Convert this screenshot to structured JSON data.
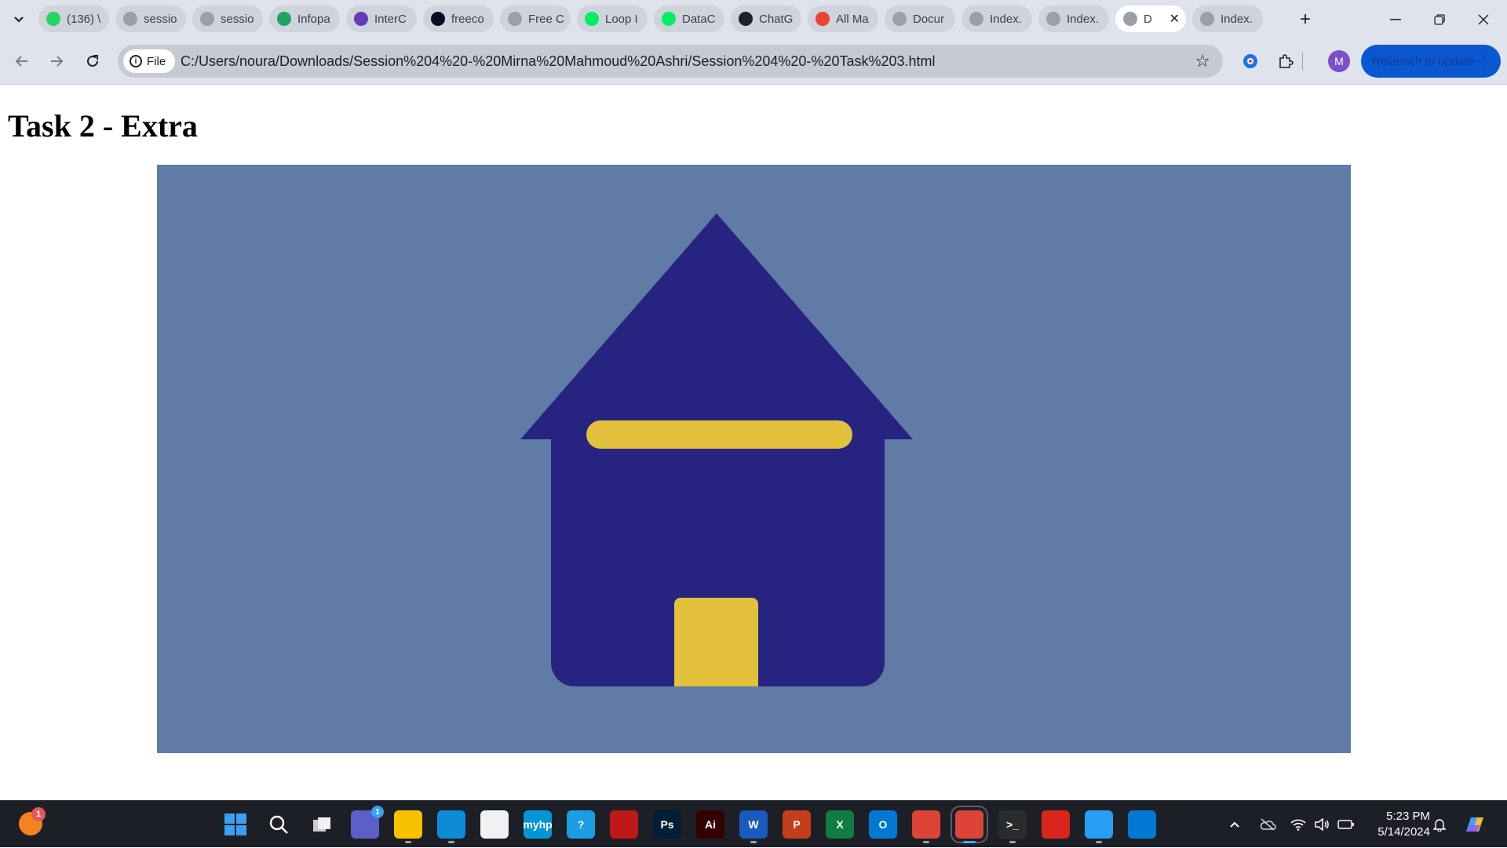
{
  "browser": {
    "tabs": [
      {
        "label": "(136) \\",
        "icon": "whatsapp-icon",
        "color": "#25d366"
      },
      {
        "label": "sessio",
        "icon": "globe-icon",
        "color": "#9aa0a6"
      },
      {
        "label": "sessio",
        "icon": "globe-icon",
        "color": "#9aa0a6"
      },
      {
        "label": "Infopa",
        "icon": "google-drive-icon",
        "color": "#1fa463"
      },
      {
        "label": "InterC",
        "icon": "forms-icon",
        "color": "#673ab7"
      },
      {
        "label": "freeco",
        "icon": "freecodecamp-icon",
        "color": "#0a0a23"
      },
      {
        "label": "Free C",
        "icon": "globe-icon",
        "color": "#9aa0a6"
      },
      {
        "label": "Loop I",
        "icon": "datacamp-icon",
        "color": "#03ef62"
      },
      {
        "label": "DataC",
        "icon": "datacamp-icon",
        "color": "#03ef62"
      },
      {
        "label": "ChatG",
        "icon": "chatgpt-icon",
        "color": "#202124"
      },
      {
        "label": "All Ma",
        "icon": "gmail-icon",
        "color": "#ea4335"
      },
      {
        "label": "Docur",
        "icon": "globe-icon",
        "color": "#9aa0a6"
      },
      {
        "label": "Index.",
        "icon": "globe-icon",
        "color": "#9aa0a6"
      },
      {
        "label": "Index.",
        "icon": "globe-icon",
        "color": "#9aa0a6"
      },
      {
        "label": "D",
        "icon": "globe-icon",
        "color": "#9aa0a6",
        "active": true
      },
      {
        "label": "Index.",
        "icon": "globe-icon",
        "color": "#9aa0a6"
      }
    ],
    "file_chip": "File",
    "url": "C:/Users/noura/Downloads/Session%204%20-%20Mirna%20Mahmoud%20Ashri/Session%204%20-%20Task%203.html",
    "profile_initial": "M",
    "relaunch_label": "Relaunch to update"
  },
  "page": {
    "heading": "Task 2 - Extra",
    "colors": {
      "background": "#607ca6",
      "house": "#262480",
      "accent": "#e2c13b"
    }
  },
  "taskbar": {
    "start_badge": "1",
    "teams_badge": "1",
    "time": "5:23 PM",
    "date": "5/14/2024",
    "apps": [
      {
        "name": "start-button",
        "label": "",
        "color": "#1e90ff"
      },
      {
        "name": "search-button",
        "label": "",
        "color": "transparent"
      },
      {
        "name": "task-view-button",
        "label": "",
        "color": "transparent"
      },
      {
        "name": "teams-button",
        "label": "",
        "color": "#5b5fc7"
      },
      {
        "name": "file-explorer-button",
        "label": "",
        "color": "#f8c200"
      },
      {
        "name": "edge-button",
        "label": "",
        "color": "#0c8bd6"
      },
      {
        "name": "store-button",
        "label": "",
        "color": "#f1f1f1"
      },
      {
        "name": "myhp-button",
        "label": "myhp",
        "color": "#0096d6"
      },
      {
        "name": "help-button",
        "label": "?",
        "color": "#1b9de2"
      },
      {
        "name": "mcafee-button",
        "label": "",
        "color": "#c01818"
      },
      {
        "name": "photoshop-button",
        "label": "Ps",
        "color": "#001e36"
      },
      {
        "name": "illustrator-button",
        "label": "Ai",
        "color": "#330000"
      },
      {
        "name": "word-button",
        "label": "W",
        "color": "#185abd"
      },
      {
        "name": "powerpoint-button",
        "label": "P",
        "color": "#c43e1c"
      },
      {
        "name": "excel-button",
        "label": "X",
        "color": "#107c41"
      },
      {
        "name": "outlook-button",
        "label": "O",
        "color": "#0078d4"
      },
      {
        "name": "chrome-button",
        "label": "",
        "color": "#db4437"
      },
      {
        "name": "chrome-profile-button",
        "label": "",
        "color": "#db4437"
      },
      {
        "name": "terminal-button",
        "label": ">_",
        "color": "#2b2b2b"
      },
      {
        "name": "acrobat-button",
        "label": "",
        "color": "#d8261c"
      },
      {
        "name": "photos-button",
        "label": "",
        "color": "#2a9df4"
      },
      {
        "name": "vscode-button",
        "label": "",
        "color": "#0078d4"
      }
    ]
  }
}
